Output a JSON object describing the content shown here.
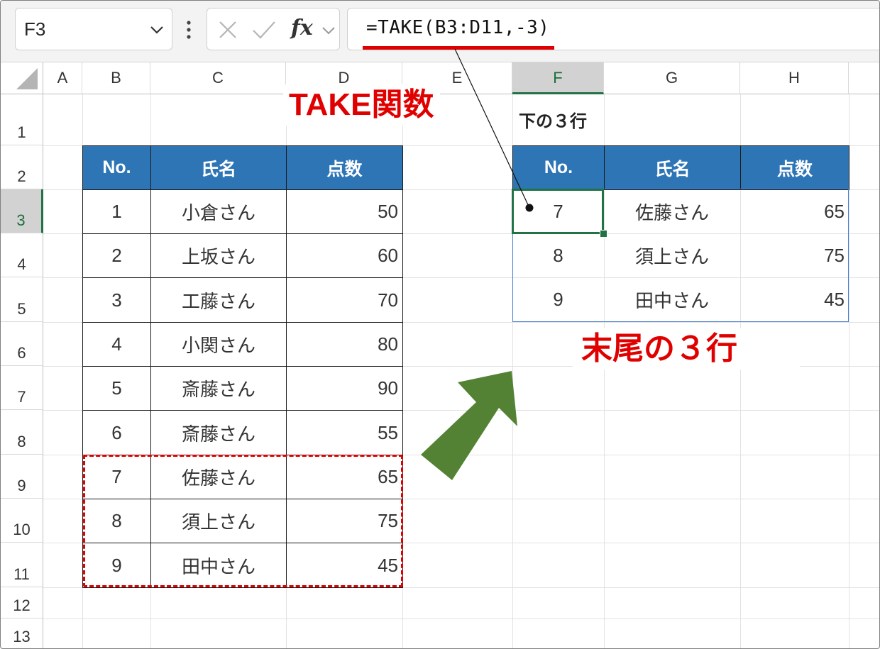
{
  "name_box": {
    "value": "F3"
  },
  "formula_bar": {
    "formula": "=TAKE(B3:D11,-3)",
    "fx_label": "fx"
  },
  "columns": [
    "A",
    "B",
    "C",
    "D",
    "E",
    "F",
    "G",
    "H"
  ],
  "rows": [
    "1",
    "2",
    "3",
    "4",
    "5",
    "6",
    "7",
    "8",
    "9",
    "10",
    "11",
    "12",
    "13"
  ],
  "selected": {
    "column": "F",
    "row": "3"
  },
  "source_table": {
    "headers": [
      "No.",
      "氏名",
      "点数"
    ],
    "rows": [
      [
        "1",
        "小倉さん",
        "50"
      ],
      [
        "2",
        "上坂さん",
        "60"
      ],
      [
        "3",
        "工藤さん",
        "70"
      ],
      [
        "4",
        "小関さん",
        "80"
      ],
      [
        "5",
        "斎藤さん",
        "90"
      ],
      [
        "6",
        "斎藤さん",
        "55"
      ],
      [
        "7",
        "佐藤さん",
        "65"
      ],
      [
        "8",
        "須上さん",
        "75"
      ],
      [
        "9",
        "田中さん",
        "45"
      ]
    ]
  },
  "result_label": "下の３行",
  "result_table": {
    "headers": [
      "No.",
      "氏名",
      "点数"
    ],
    "rows": [
      [
        "7",
        "佐藤さん",
        "65"
      ],
      [
        "8",
        "須上さん",
        "75"
      ],
      [
        "9",
        "田中さん",
        "45"
      ]
    ]
  },
  "annotations": {
    "function_name": "TAKE関数",
    "tail_rows": "末尾の３行"
  },
  "colors": {
    "header_fill": "#2e75b6",
    "accent_red": "#e00000",
    "arrow_green": "#548235",
    "excel_green": "#217346"
  },
  "icons": [
    "chevron-down-icon",
    "more-vertical-icon",
    "cancel-x-icon",
    "check-icon",
    "fx-icon",
    "arrow-up-right-icon"
  ]
}
